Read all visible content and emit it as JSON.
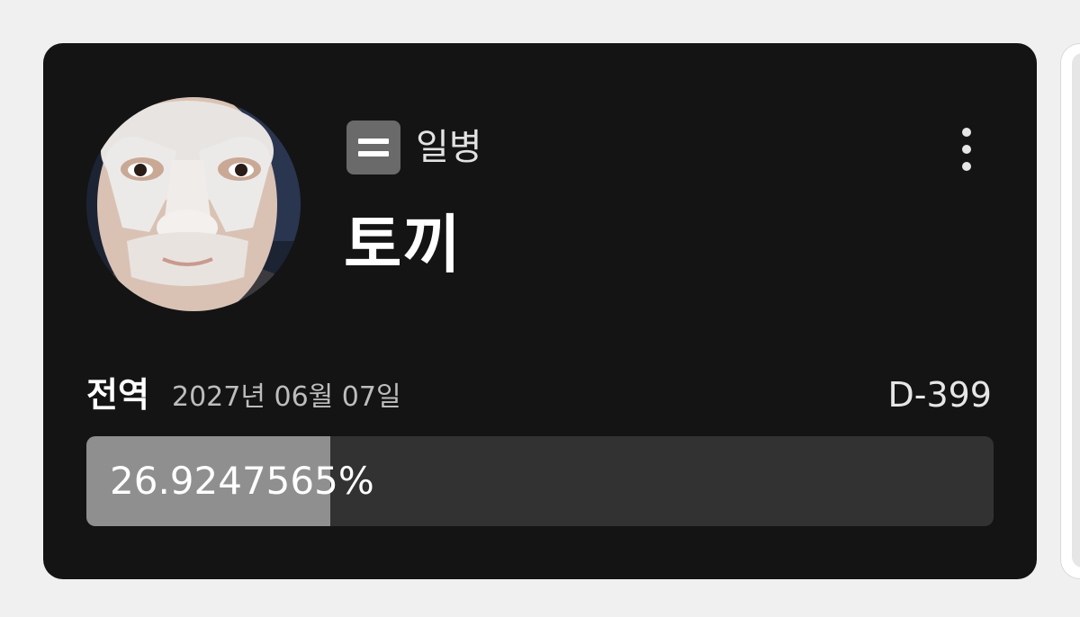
{
  "profile": {
    "rank_label": "일병",
    "rank_icon": "rank-badge-two-bars-icon",
    "name": "토끼"
  },
  "service": {
    "discharge_label": "전역",
    "discharge_date": "2027년 06월 07일",
    "d_day": "D-399",
    "progress_text": "26.9247565%",
    "progress_percent": 26.9247565
  },
  "menu_icon": "more-vertical-icon",
  "colors": {
    "card_background": "#141414",
    "progress_fill": "#8f8f8f",
    "progress_track": "#323232",
    "rank_icon_background": "#6a6a6a"
  }
}
